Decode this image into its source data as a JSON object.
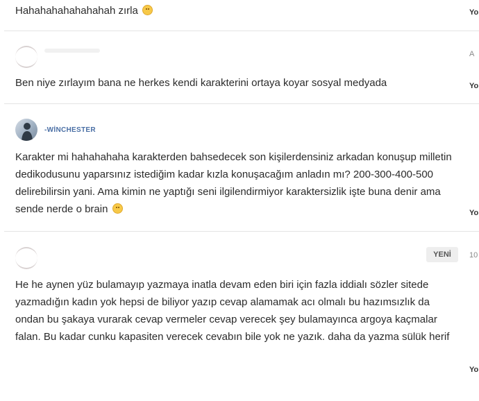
{
  "comments": [
    {
      "text": "Hahahahahahahahah zırla",
      "has_emoji": true,
      "side_label": "Yo"
    },
    {
      "username": "",
      "text": "Ben niye zırlayım bana ne herkes kendi karakterini ortaya koyar sosyal medyada",
      "side_label": "Yo",
      "side_mark": "A"
    },
    {
      "username": "-WİNCHESTER",
      "text": "Karakter mi hahahahaha karakterden bahsedecek son kişilerdensiniz arkadan konuşup milletin dedikodusunu yaparsınız istediğim kadar kızla konuşacağım anladın mı? 200-300-400-500 delirebilirsin yani. Ama kimin ne yaptığı seni ilgilendirmiyor karaktersizlik işte buna denir ama sende nerde o brain",
      "has_emoji": true,
      "side_label": "Yo"
    },
    {
      "username": "",
      "badge": "YENİ",
      "side_number": "10",
      "text": "He he aynen yüz bulamayıp yazmaya inatla devam eden biri için fazla iddialı sözler sitede yazmadığın kadın yok hepsi de biliyor yazıp cevap alamamak acı olmalı bu hazımsızlık da ondan bu şakaya vurarak cevap vermeler cevap verecek şey bulamayınca argoya kaçmalar falan. Bu kadar cunku kapasiten verecek cevabın bile yok ne yazık. daha da yazma sülük herif",
      "side_label": "Yo"
    }
  ],
  "colors": {
    "username": "#4a6fa5",
    "text": "#2b2b2b",
    "divider": "#e4e4e4",
    "badge_bg": "#eeeeee"
  }
}
